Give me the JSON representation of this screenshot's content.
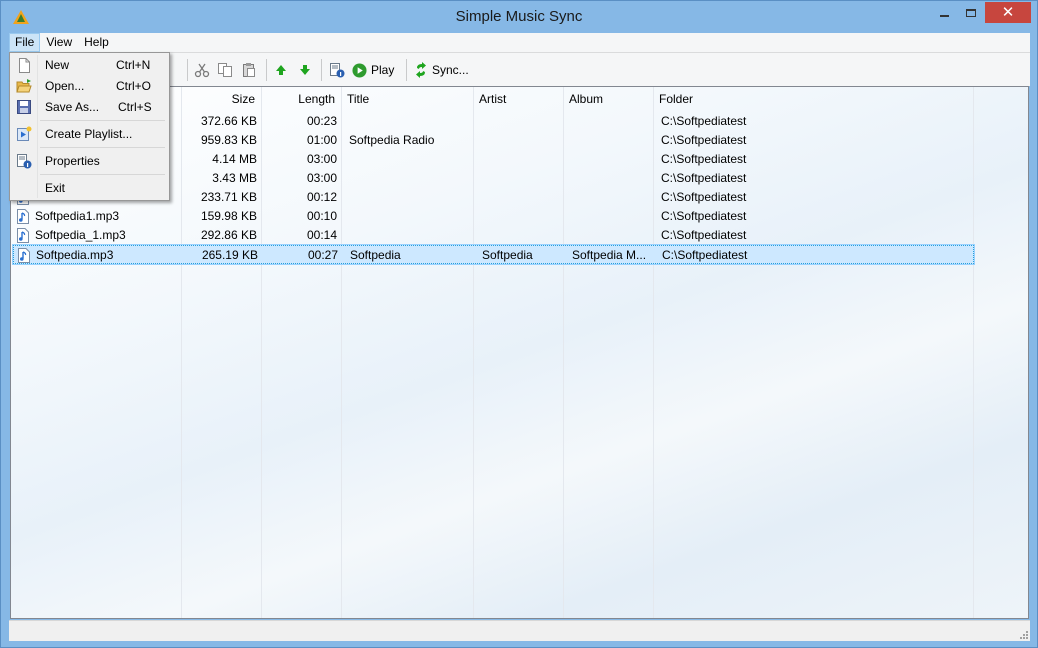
{
  "window": {
    "title": "Simple Music Sync",
    "close_glyph": "✕"
  },
  "menubar": {
    "items": [
      "File",
      "View",
      "Help"
    ]
  },
  "toolbar": {
    "play_label": "Play",
    "sync_label": "Sync..."
  },
  "file_menu": {
    "items": [
      {
        "label": "New",
        "shortcut": "Ctrl+N",
        "icon": "new-document-icon"
      },
      {
        "label": "Open...",
        "shortcut": "Ctrl+O",
        "icon": "open-folder-icon"
      },
      {
        "label": "Save As...",
        "shortcut": "Ctrl+S",
        "icon": "save-disk-icon"
      },
      {
        "label": "Create Playlist...",
        "shortcut": "",
        "icon": "playlist-icon"
      },
      {
        "label": "Properties",
        "shortcut": "",
        "icon": "properties-icon"
      },
      {
        "label": "Exit",
        "shortcut": "",
        "icon": ""
      }
    ]
  },
  "table": {
    "columns": [
      "Size",
      "Length",
      "Title",
      "Artist",
      "Album",
      "Folder"
    ],
    "rows": [
      {
        "name": "",
        "size": "372.66 KB",
        "length": "00:23",
        "title": "",
        "artist": "",
        "album": "",
        "folder": "C:\\Softpediatest"
      },
      {
        "name": "",
        "size": "959.83 KB",
        "length": "01:00",
        "title": "Softpedia Radio",
        "artist": "",
        "album": "",
        "folder": "C:\\Softpediatest"
      },
      {
        "name": "",
        "size": "4.14 MB",
        "length": "03:00",
        "title": "",
        "artist": "",
        "album": "",
        "folder": "C:\\Softpediatest"
      },
      {
        "name": "",
        "size": "3.43 MB",
        "length": "03:00",
        "title": "",
        "artist": "",
        "album": "",
        "folder": "C:\\Softpediatest"
      },
      {
        "name": "",
        "size": "233.71 KB",
        "length": "00:12",
        "title": "",
        "artist": "",
        "album": "",
        "folder": "C:\\Softpediatest"
      },
      {
        "name": "Softpedia1.mp3",
        "size": "159.98 KB",
        "length": "00:10",
        "title": "",
        "artist": "",
        "album": "",
        "folder": "C:\\Softpediatest"
      },
      {
        "name": "Softpedia_1.mp3",
        "size": "292.86 KB",
        "length": "00:14",
        "title": "",
        "artist": "",
        "album": "",
        "folder": "C:\\Softpediatest"
      },
      {
        "name": "Softpedia.mp3",
        "size": "265.19 KB",
        "length": "00:27",
        "title": "Softpedia",
        "artist": "Softpedia",
        "album": "Softpedia M...",
        "folder": "C:\\Softpediatest",
        "selected": true
      }
    ]
  },
  "colors": {
    "titlebar": "#86b8e6",
    "close_button": "#c7463e",
    "selection": "#cde8ff",
    "play_green": "#2e9b2e",
    "arrow_green": "#1fa51f"
  }
}
